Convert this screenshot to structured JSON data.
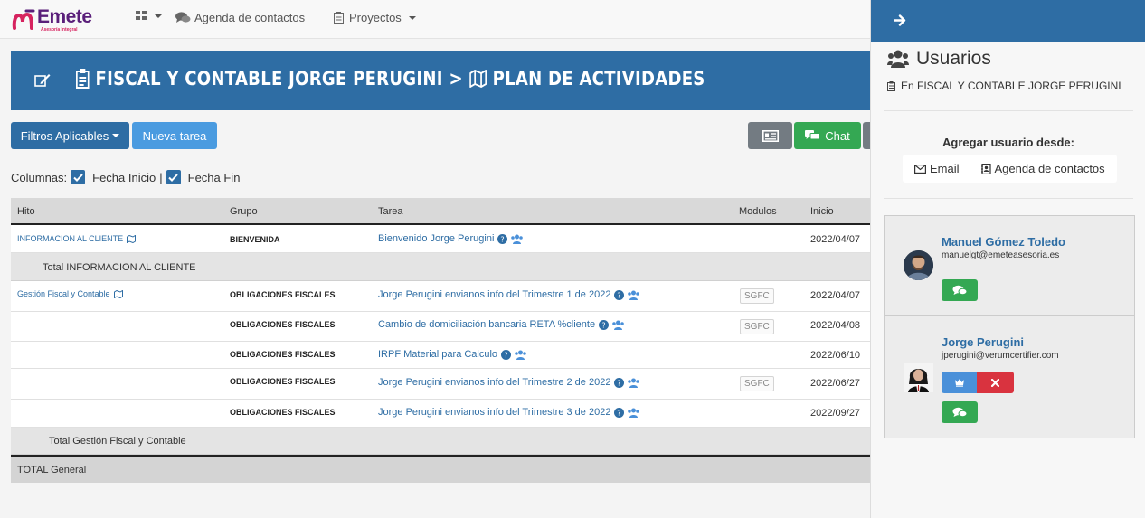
{
  "brand": {
    "name": "Emete",
    "tagline": "Asesoría Integral"
  },
  "nav": {
    "agenda": "Agenda de contactos",
    "proyectos": "Proyectos"
  },
  "header": {
    "client": "FISCAL Y CONTABLE JORGE PERUGINI",
    "separator": ">",
    "section": "PLAN DE ACTIVIDADES"
  },
  "toolbar": {
    "filtros": "Filtros Aplicables",
    "nueva": "Nueva tarea",
    "chat": "Chat"
  },
  "columns": {
    "label": "Columnas:",
    "opt1": "Fecha Inicio",
    "sep": "|",
    "opt2": "Fecha Fin"
  },
  "table": {
    "headers": {
      "hito": "Hito",
      "grupo": "Grupo",
      "tarea": "Tarea",
      "modulos": "Modulos",
      "inicio": "Inicio"
    },
    "rows": [
      {
        "hito": "INFORMACION AL CLIENTE",
        "grupo": "BIENVENIDA",
        "tarea": "Bienvenido Jorge Perugini",
        "modulo": "",
        "inicio": "2022/04/07"
      },
      {
        "hito": "Gestión Fiscal y Contable",
        "grupo": "OBLIGACIONES FISCALES",
        "tarea": "Jorge Perugini envianos info del Trimestre 1 de 2022",
        "modulo": "SGFC",
        "inicio": "2022/04/07"
      },
      {
        "hito": "",
        "grupo": "OBLIGACIONES FISCALES",
        "tarea": "Cambio de domiciliación bancaria RETA %cliente",
        "modulo": "SGFC",
        "inicio": "2022/04/08"
      },
      {
        "hito": "",
        "grupo": "OBLIGACIONES FISCALES",
        "tarea": "IRPF Material para Calculo",
        "modulo": "",
        "inicio": "2022/06/10"
      },
      {
        "hito": "",
        "grupo": "OBLIGACIONES FISCALES",
        "tarea": "Jorge Perugini envianos info del Trimestre 2 de 2022",
        "modulo": "SGFC",
        "inicio": "2022/06/27"
      },
      {
        "hito": "",
        "grupo": "OBLIGACIONES FISCALES",
        "tarea": "Jorge Perugini envianos info del Trimestre 3 de 2022",
        "modulo": "",
        "inicio": "2022/09/27"
      }
    ],
    "subtotal1": "Total INFORMACION AL CLIENTE",
    "subtotal2": "Total Gestión Fiscal y Contable",
    "total": "TOTAL General"
  },
  "panel": {
    "title": "Usuarios",
    "subtitle": "En FISCAL Y CONTABLE JORGE PERUGINI",
    "agregar": "Agregar usuario desde:",
    "email": "Email",
    "agenda": "Agenda de contactos",
    "users": [
      {
        "name": "Manuel Gómez Toledo",
        "email": "manuelgt@emeteasesoria.es"
      },
      {
        "name": "Jorge Perugini",
        "email": "jperugini@verumcertifier.com"
      }
    ]
  },
  "colors": {
    "primary": "#2e6da4",
    "accent": "#4a9be0",
    "success": "#34a853",
    "danger": "#d9333f",
    "brand": "#5a1f7a"
  }
}
